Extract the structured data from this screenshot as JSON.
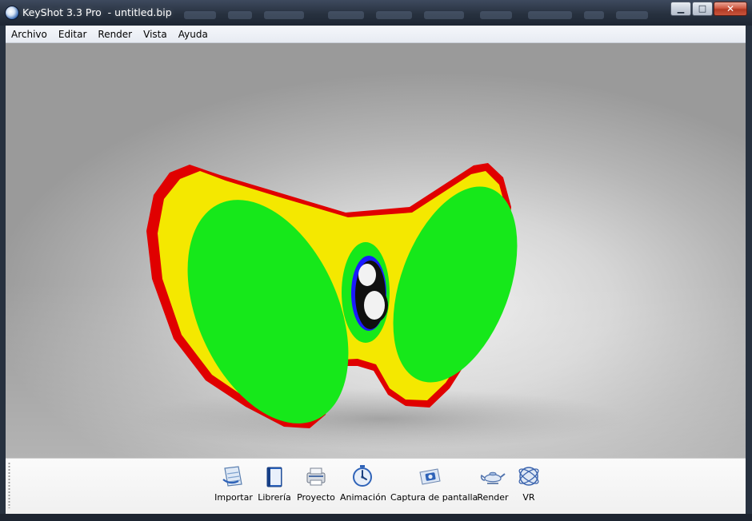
{
  "window": {
    "title": "KeyShot 3.3 Pro  - untitled.bip",
    "minimize_glyph": "▁",
    "maximize_glyph": "□",
    "close_glyph": "✕"
  },
  "menu": {
    "items": [
      {
        "label": "Archivo"
      },
      {
        "label": "Editar"
      },
      {
        "label": "Render"
      },
      {
        "label": "Vista"
      },
      {
        "label": "Ayuda"
      }
    ]
  },
  "scene": {
    "colors": {
      "rim": "#e00000",
      "body": "#f4e800",
      "lens": "#16e81a",
      "badge_blue": "#1a1aff",
      "badge_black": "#101010",
      "badge_white": "#f2f2f2"
    }
  },
  "toolbar": {
    "buttons": [
      {
        "label": "Importar",
        "icon": "import-icon"
      },
      {
        "label": "Librería",
        "icon": "library-icon"
      },
      {
        "label": "Proyecto",
        "icon": "project-icon"
      },
      {
        "label": "Animación",
        "icon": "animation-icon"
      },
      {
        "label": "Captura de pantalla",
        "icon": "screenshot-icon"
      },
      {
        "label": "Render",
        "icon": "render-icon"
      },
      {
        "label": "VR",
        "icon": "vr-icon"
      }
    ]
  }
}
